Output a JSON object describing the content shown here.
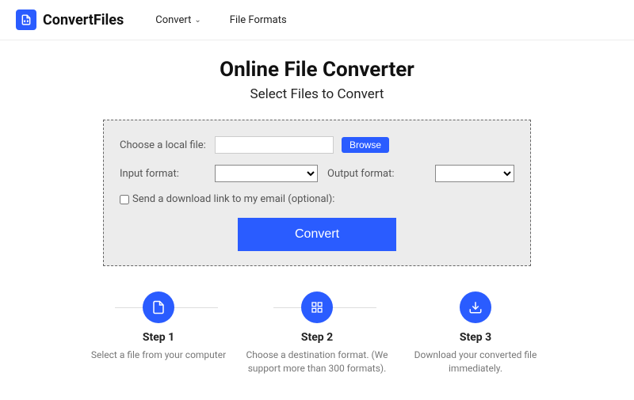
{
  "nav": {
    "brand": "ConvertFiles",
    "link_convert": "Convert",
    "link_formats": "File Formats"
  },
  "hero": {
    "title": "Online File Converter",
    "subtitle": "Select Files to Convert"
  },
  "form": {
    "choose_label": "Choose a local file:",
    "file_value": "",
    "browse_label": "Browse",
    "input_format_label": "Input format:",
    "output_format_label": "Output format:",
    "email_checkbox_label": "Send a download link to my email (optional):",
    "convert_button": "Convert"
  },
  "steps": [
    {
      "title": "Step 1",
      "desc": "Select a file from your computer"
    },
    {
      "title": "Step 2",
      "desc": "Choose a destination format. (We support more than 300 formats)."
    },
    {
      "title": "Step 3",
      "desc": "Download your converted file immediately."
    }
  ]
}
